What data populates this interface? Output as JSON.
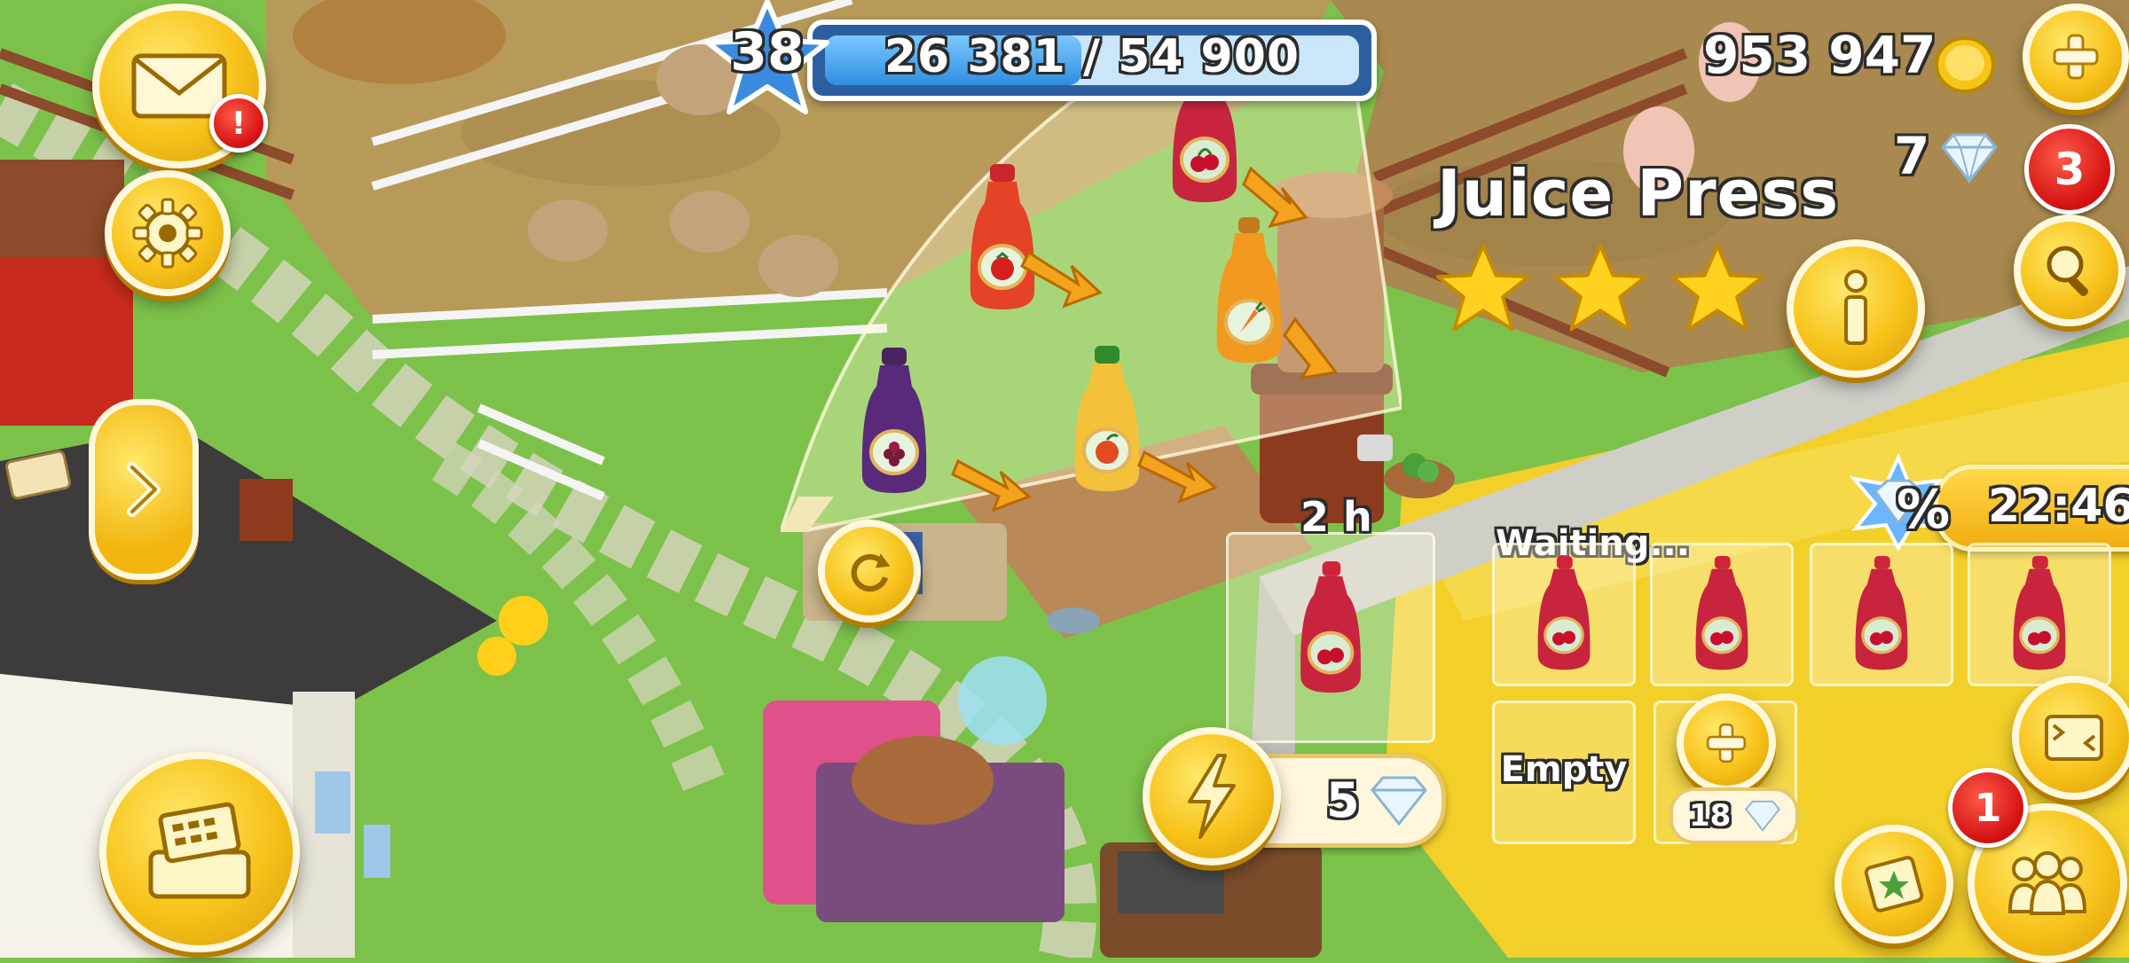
{
  "hud": {
    "level": "38",
    "xp_text": "26 381 / 54 900",
    "xp_progress": 0.4806,
    "coins": "953 947",
    "diamonds": "7",
    "mail_alert": "!",
    "notification_count": "3",
    "friends_count": "1",
    "offer_timer": "22:46",
    "offer_percent": "%"
  },
  "juice_press": {
    "title": "Juice Press",
    "stars": 3,
    "current_time": "2 h",
    "waiting_label": "Waiting...",
    "empty_label": "Empty",
    "finish_cost": "5",
    "unlock_cost": "18"
  },
  "recipes": [
    {
      "name": "cherry-juice",
      "color": "#c8243e",
      "fruit": "cherry"
    },
    {
      "name": "tomato-juice",
      "color": "#e44327",
      "fruit": "tomato"
    },
    {
      "name": "carrot-juice",
      "color": "#f19a1f",
      "fruit": "carrot"
    },
    {
      "name": "apple-juice",
      "color": "#f3c23a",
      "fruit": "apple"
    },
    {
      "name": "blackberry-juice",
      "color": "#5a2a7a",
      "fruit": "blackberry"
    }
  ],
  "queue": [
    {
      "item": "cherry-juice"
    },
    {
      "item": "cherry-juice"
    },
    {
      "item": "cherry-juice"
    },
    {
      "item": "cherry-juice"
    }
  ],
  "icons": {
    "mail": "envelope-icon",
    "settings": "gear-icon",
    "expand": "chevron-right-icon",
    "shop": "cash-register-icon",
    "add": "plus-icon",
    "search": "magnifier-icon",
    "info": "info-icon",
    "boost": "lightning-icon",
    "friends": "people-icon",
    "map": "map-icon",
    "screenshot": "screen-capture-icon"
  }
}
